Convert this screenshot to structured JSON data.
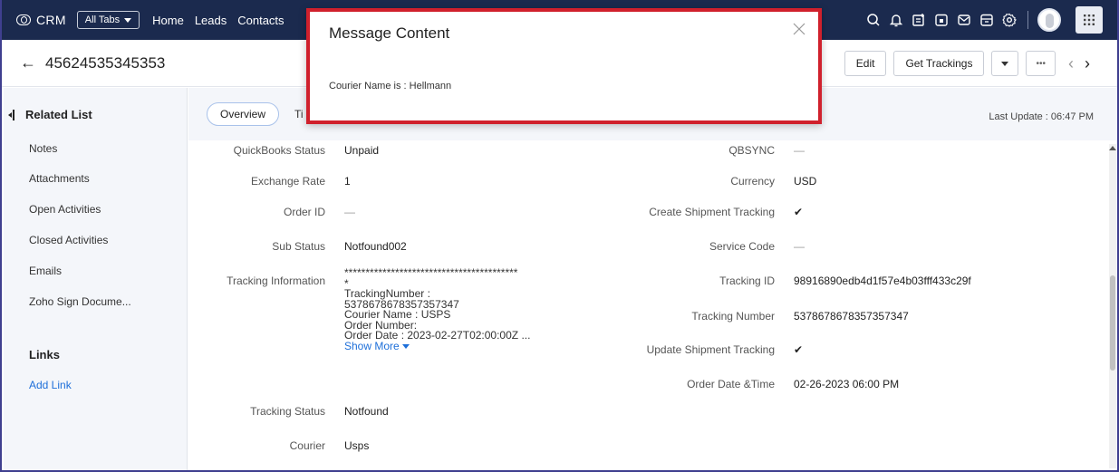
{
  "nav": {
    "logo": "CRM",
    "all_tabs": "All Tabs",
    "links": [
      "Home",
      "Leads",
      "Contacts"
    ]
  },
  "record": {
    "title": "45624535345353",
    "edit_label": "Edit",
    "get_trackings_label": "Get Trackings",
    "more_label": "•••"
  },
  "sidebar": {
    "heading": "Related List",
    "items": [
      "Notes",
      "Attachments",
      "Open Activities",
      "Closed Activities",
      "Emails",
      "Zoho Sign Docume..."
    ],
    "links_heading": "Links",
    "add_link": "Add Link"
  },
  "tabs": {
    "overview": "Overview",
    "next_partial": "Ti",
    "last_update": "Last Update : 06:47 PM"
  },
  "fields_left": [
    {
      "label": "QuickBooks Status",
      "value": "Unpaid"
    },
    {
      "label": "Exchange Rate",
      "value": "1"
    },
    {
      "label": "Order ID",
      "value": "—"
    },
    {
      "label": "Sub Status",
      "value": "Notfound002"
    },
    {
      "label": "Tracking Information",
      "value": ""
    },
    {
      "label": "Tracking Status",
      "value": "Notfound"
    },
    {
      "label": "Courier",
      "value": "Usps"
    }
  ],
  "tracking_info": {
    "stars": "*****************************************",
    "star2": "*",
    "line1": "TrackingNumber :",
    "line2": "5378678678357357347",
    "line3": "Courier Name :  USPS",
    "line4": "Order Number:",
    "line5": "Order Date :  2023-02-27T02:00:00Z    ...",
    "show_more": "Show More"
  },
  "fields_right": [
    {
      "label": "QBSYNC",
      "value": "—"
    },
    {
      "label": "Currency",
      "value": "USD"
    },
    {
      "label": "Create Shipment Tracking",
      "value": "✔"
    },
    {
      "label": "Service Code",
      "value": "—"
    },
    {
      "label": "Tracking ID",
      "value": "98916890edb4d1f57e4b03fff433c29f"
    },
    {
      "label": "Tracking Number",
      "value": "5378678678357357347"
    },
    {
      "label": "Update Shipment Tracking",
      "value": "✔"
    },
    {
      "label": "Order Date &Time",
      "value": "02-26-2023 06:00 PM"
    }
  ],
  "modal": {
    "title": "Message Content",
    "body": "Courier Name is : Hellmann"
  },
  "colors": {
    "topnav": "#1b2a4e",
    "modal_border": "#d0202c",
    "link": "#1e6fd9"
  }
}
